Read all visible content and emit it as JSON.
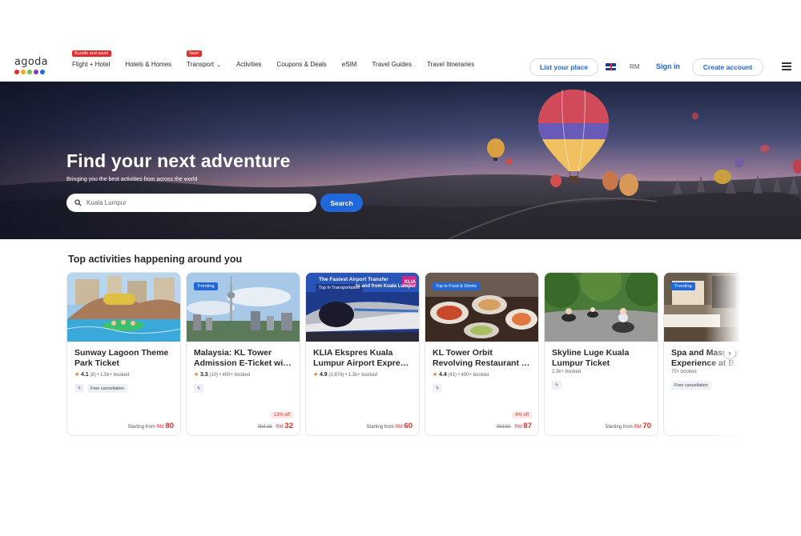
{
  "brand": {
    "logo_text": "agoda",
    "dot_colors": [
      "#e12d2d",
      "#f5a623",
      "#7ac143",
      "#8a3ab9",
      "#2067da"
    ]
  },
  "nav": {
    "items": [
      {
        "label": "Flight + Hotel",
        "badge": "Bundle and save!",
        "chevron": false
      },
      {
        "label": "Hotels & Homes",
        "badge": "",
        "chevron": false
      },
      {
        "label": "Transport",
        "badge": "New!",
        "chevron": true
      },
      {
        "label": "Activities",
        "badge": "",
        "chevron": false
      },
      {
        "label": "Coupons & Deals",
        "badge": "",
        "chevron": false
      },
      {
        "label": "eSIM",
        "badge": "",
        "chevron": false
      },
      {
        "label": "Travel Guides",
        "badge": "",
        "chevron": false
      },
      {
        "label": "Travel Itineraries",
        "badge": "",
        "chevron": false
      }
    ],
    "list_place": "List your place",
    "currency": "RM",
    "sign_in": "Sign in",
    "create_account": "Create account"
  },
  "hero": {
    "title": "Find your next adventure",
    "subtitle": "Bringing you the best activities from across the world",
    "search_value": "Kuala Lumpur",
    "search_button": "Search"
  },
  "section": {
    "title": "Top activities happening around you"
  },
  "cards": [
    {
      "title": "Sunway Lagoon Theme Park Ticket",
      "tag": "",
      "rating": "4.1",
      "reviews": "(8)",
      "booked": "1.5k+ booked",
      "free_cancel": "Free cancellation",
      "discount": "",
      "old_price": "",
      "price_prefix": "Starting from",
      "currency": "RM",
      "price": "80"
    },
    {
      "title": "Malaysia: KL Tower Admission E-Ticket wi…",
      "tag": "Trending",
      "rating": "3.3",
      "reviews": "(10)",
      "booked": "400+ booked",
      "free_cancel": "",
      "discount": "13% off",
      "old_price": "RM 36",
      "price_prefix": "",
      "currency": "RM",
      "price": "32"
    },
    {
      "title": "KLIA Ekspres Kuala Lumpur Airport Expre…",
      "tag": "Top in Transportation",
      "rating": "4.9",
      "reviews": "(2,874)",
      "booked": "1.2k+ booked",
      "free_cancel": "",
      "discount": "",
      "old_price": "",
      "price_prefix": "Starting from",
      "currency": "RM",
      "price": "60"
    },
    {
      "title": "KL Tower Orbit Revolving Restaurant …",
      "tag": "Top in Food & Drinks",
      "rating": "4.4",
      "reviews": "(41)",
      "booked": "400+ booked",
      "free_cancel": "",
      "discount": "4% off",
      "old_price": "RM 90",
      "price_prefix": "",
      "currency": "RM",
      "price": "87"
    },
    {
      "title": "Skyline Luge Kuala Lumpur Ticket",
      "tag": "",
      "rating": "",
      "reviews": "",
      "booked": "2.3k+ booked",
      "free_cancel": "",
      "discount": "",
      "old_price": "",
      "price_prefix": "Starting from",
      "currency": "RM",
      "price": "70"
    },
    {
      "title": "Spa and Massage Experience at B…",
      "tag": "Trending",
      "rating": "",
      "reviews": "",
      "booked": "75+ booked",
      "free_cancel": "Free cancellation",
      "discount": "",
      "old_price": "",
      "price_prefix": "",
      "currency": "",
      "price": ""
    }
  ],
  "card3_banner": {
    "line1": "The Fastest Airport Transfer",
    "line2": "to and from Kuala Lumpur",
    "badge": "KLIA"
  },
  "colors": {
    "accent": "#2067da",
    "price": "#e12d2d",
    "star": "#e0762a"
  }
}
